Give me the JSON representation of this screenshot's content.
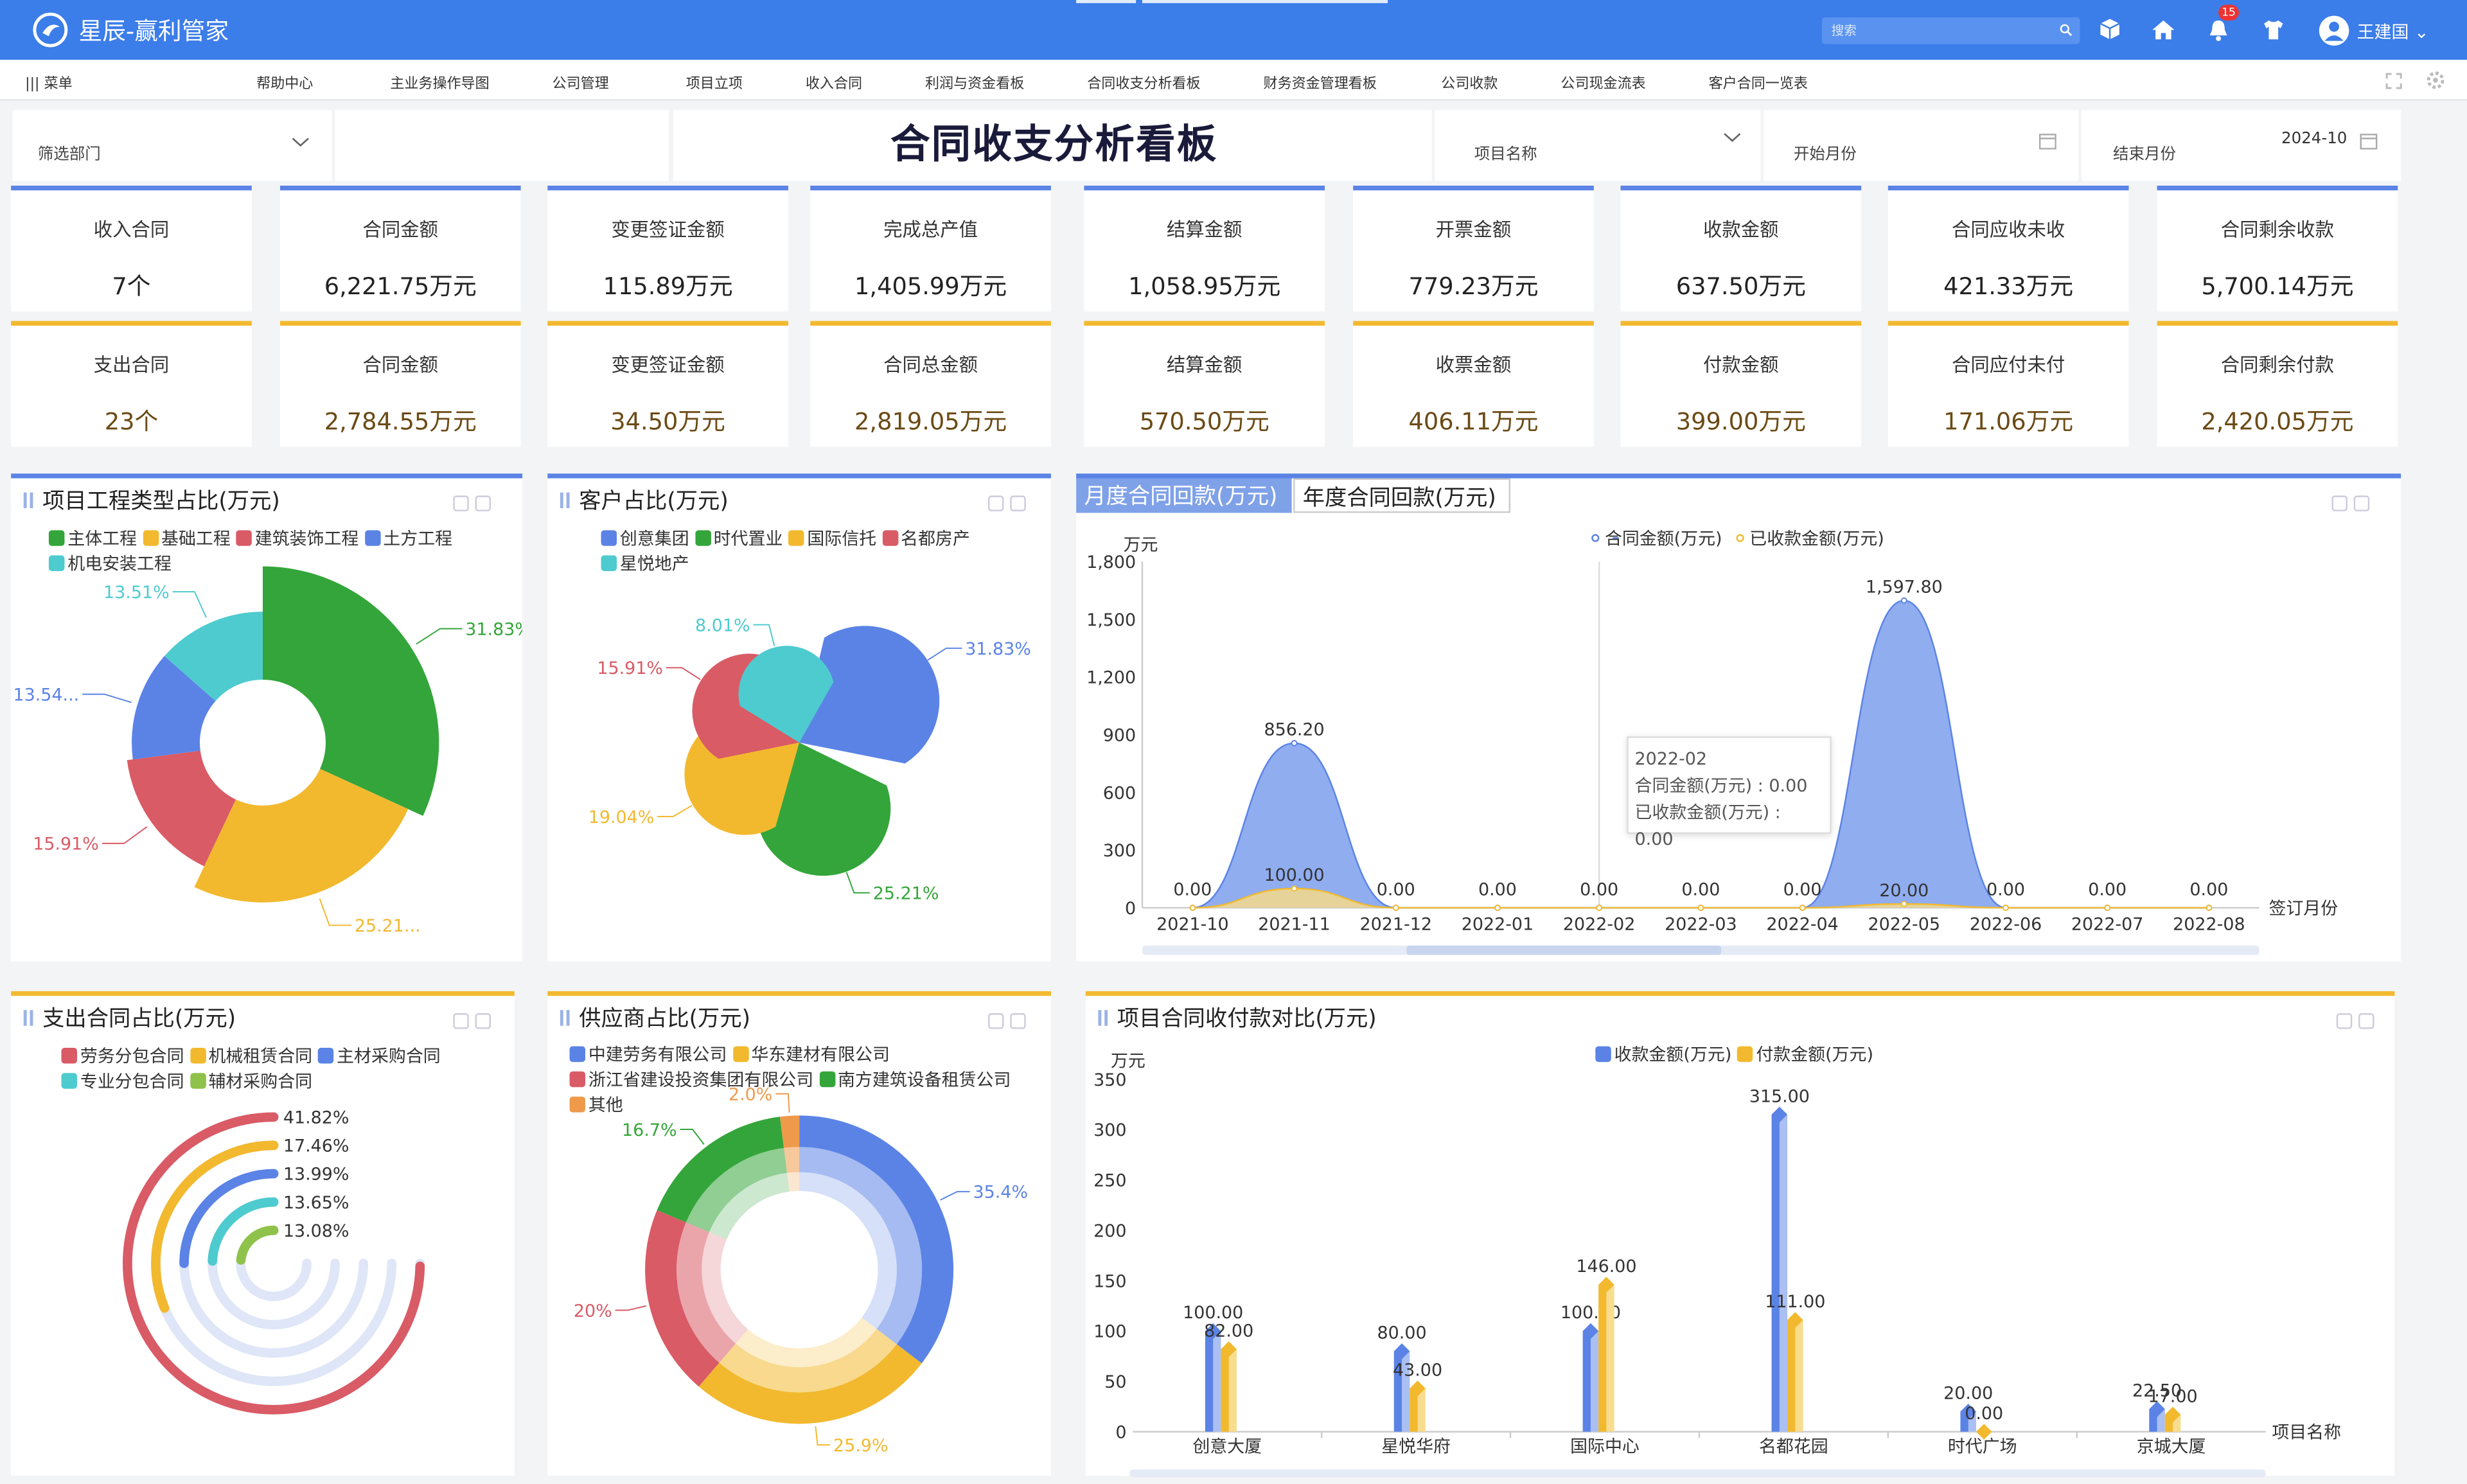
{
  "app": {
    "title": "星辰-赢利管家"
  },
  "topbar": {
    "search_placeholder": "搜索",
    "notification_count": "15",
    "user_name": "王建国"
  },
  "nav": {
    "menu_label": "菜单",
    "items": [
      "帮助中心",
      "主业务操作导图",
      "公司管理",
      "项目立项",
      "收入合同",
      "利润与资金看板",
      "合同收支分析看板",
      "财务资金管理看板",
      "公司收款",
      "公司现金流表",
      "客户合同一览表"
    ]
  },
  "filters": {
    "department": "筛选部门",
    "project_name": "项目名称",
    "start_month": "开始月份",
    "end_month_label": "结束月份",
    "end_month_value": "2024-10"
  },
  "dashboard": {
    "title": "合同收支分析看板"
  },
  "income_kpis": [
    {
      "label": "收入合同",
      "value": "7个"
    },
    {
      "label": "合同金额",
      "value": "6,221.75万元"
    },
    {
      "label": "变更签证金额",
      "value": "115.89万元"
    },
    {
      "label": "完成总产值",
      "value": "1,405.99万元"
    },
    {
      "label": "结算金额",
      "value": "1,058.95万元"
    },
    {
      "label": "开票金额",
      "value": "779.23万元"
    },
    {
      "label": "收款金额",
      "value": "637.50万元"
    },
    {
      "label": "合同应收未收",
      "value": "421.33万元"
    },
    {
      "label": "合同剩余收款",
      "value": "5,700.14万元"
    }
  ],
  "expense_kpis": [
    {
      "label": "支出合同",
      "value": "23个"
    },
    {
      "label": "合同金额",
      "value": "2,784.55万元"
    },
    {
      "label": "变更签证金额",
      "value": "34.50万元"
    },
    {
      "label": "合同总金额",
      "value": "2,819.05万元"
    },
    {
      "label": "结算金额",
      "value": "570.50万元"
    },
    {
      "label": "收票金额",
      "value": "406.11万元"
    },
    {
      "label": "付款金额",
      "value": "399.00万元"
    },
    {
      "label": "合同应付未付",
      "value": "171.06万元"
    },
    {
      "label": "合同剩余付款",
      "value": "2,420.05万元"
    }
  ],
  "panels": {
    "project_type": {
      "title": "项目工程类型占比(万元)"
    },
    "customer": {
      "title": "客户占比(万元)"
    },
    "monthly_tab": "月度合同回款(万元)",
    "yearly_tab": "年度合同回款(万元)",
    "expense_type": {
      "title": "支出合同占比(万元)"
    },
    "supplier": {
      "title": "供应商占比(万元)"
    },
    "project_compare": {
      "title": "项目合同收付款对比(万元)"
    }
  },
  "tooltip": {
    "date": "2022-02",
    "line1": "合同金额(万元) : 0.00",
    "line2": "已收款金额(万元) : 0.00"
  },
  "colors": {
    "blue": "#5b83e6",
    "green": "#34a53a",
    "gold": "#f2b92f",
    "red": "#d95b66",
    "teal": "#4ecbcf",
    "orange": "#ef9a4b",
    "topbar": "#3b7de9"
  },
  "chart_data": [
    {
      "type": "pie",
      "title": "项目工程类型占比(万元)",
      "legend": [
        "主体工程",
        "基础工程",
        "建筑装饰工程",
        "土方工程",
        "机电安装工程"
      ],
      "labels": [
        "31.83%",
        "25.21...",
        "15.91%",
        "13.54...",
        "13.51%"
      ],
      "values": [
        31.83,
        25.21,
        15.91,
        13.54,
        13.51
      ]
    },
    {
      "type": "pie",
      "title": "客户占比(万元)",
      "legend": [
        "创意集团",
        "时代置业",
        "国际信托",
        "名都房产",
        "星悦地产"
      ],
      "labels": [
        "31.83%",
        "25.21%",
        "19.04%",
        "15.91%",
        "8.01%"
      ],
      "values": [
        31.83,
        25.21,
        19.04,
        15.91,
        8.01
      ]
    },
    {
      "type": "area",
      "title": "月度合同回款(万元)",
      "y_unit": "万元",
      "x_axis_name": "签订月份",
      "ylim": [
        0,
        1800
      ],
      "yticks": [
        "0",
        "300",
        "600",
        "900",
        "1,200",
        "1,500",
        "1,800"
      ],
      "categories": [
        "2021-10",
        "2021-11",
        "2021-12",
        "2022-01",
        "2022-02",
        "2022-03",
        "2022-04",
        "2022-05",
        "2022-06",
        "2022-07",
        "2022-08"
      ],
      "series": [
        {
          "name": "合同金额(万元)",
          "values": [
            0,
            856.2,
            0,
            0,
            0,
            0,
            0,
            1597.8,
            0,
            0,
            0
          ],
          "labels": [
            "0.00",
            "856.20",
            "0.00",
            "0.00",
            "0.00",
            "0.00",
            "0.00",
            "1,597.80",
            "0.00",
            "0.00",
            "0.00"
          ]
        },
        {
          "name": "已收款金额(万元)",
          "values": [
            0,
            100,
            0,
            0,
            0,
            0,
            0,
            20,
            0,
            0,
            0
          ],
          "labels": [
            "",
            "100.00",
            "",
            "",
            "",
            "",
            "",
            "20.00",
            "",
            "",
            ""
          ]
        }
      ]
    },
    {
      "type": "bar",
      "title": "支出合同占比(万元)",
      "legend": [
        "劳务分包合同",
        "机械租赁合同",
        "主材采购合同",
        "专业分包合同",
        "辅材采购合同"
      ],
      "labels": [
        "41.82%",
        "17.46%",
        "13.99%",
        "13.65%",
        "13.08%"
      ],
      "values": [
        41.82,
        17.46,
        13.99,
        13.65,
        13.08
      ]
    },
    {
      "type": "pie",
      "title": "供应商占比(万元)",
      "legend": [
        "中建劳务有限公司",
        "华东建材有限公司",
        "浙江省建设投资集团有限公司",
        "南方建筑设备租赁公司",
        "其他"
      ],
      "labels": [
        "35.4%",
        "25.9%",
        "20%",
        "16.7%",
        "2.0%"
      ],
      "values": [
        35.4,
        25.9,
        20,
        16.7,
        2.0
      ]
    },
    {
      "type": "bar",
      "title": "项目合同收付款对比(万元)",
      "y_unit": "万元",
      "x_axis_name": "项目名称",
      "ylim": [
        0,
        350
      ],
      "yticks": [
        "0",
        "50",
        "100",
        "150",
        "200",
        "250",
        "300",
        "350"
      ],
      "categories": [
        "创意大厦",
        "星悦华府",
        "国际中心",
        "名都花园",
        "时代广场",
        "京城大厦"
      ],
      "series": [
        {
          "name": "收款金额(万元)",
          "values": [
            100,
            80,
            100,
            315,
            20,
            22.5
          ],
          "labels": [
            "100.00",
            "80.00",
            "100.00",
            "315.00",
            "20.00",
            "22.50"
          ]
        },
        {
          "name": "付款金额(万元)",
          "values": [
            82,
            43,
            146,
            111,
            0,
            17
          ],
          "labels": [
            "82.00",
            "43.00",
            "146.00",
            "111.00",
            "0.00",
            "17.00"
          ]
        }
      ]
    }
  ]
}
